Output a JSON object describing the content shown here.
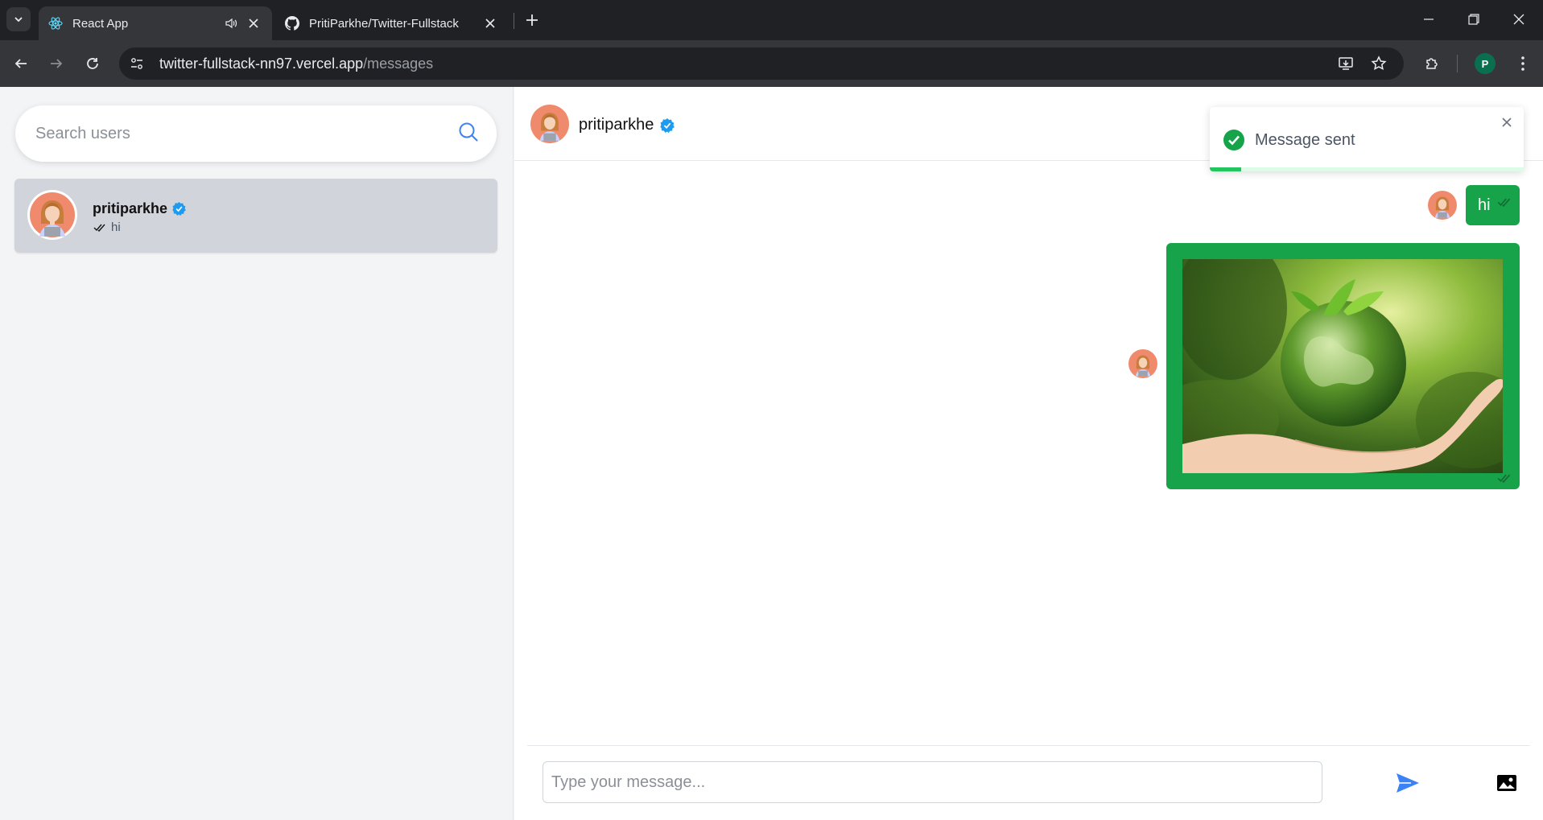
{
  "browser": {
    "tabs": [
      {
        "title": "React App",
        "favicon": "react-icon",
        "active": true
      },
      {
        "title": "PritiParkhe/Twitter-Fullstack",
        "favicon": "github-icon",
        "active": false
      }
    ],
    "url_host": "twitter-fullstack-nn97.vercel.app",
    "url_path": "/messages",
    "profile_initial": "P"
  },
  "sidebar": {
    "search_placeholder": "Search users",
    "conversations": [
      {
        "name": "pritiparkhe",
        "verified": true,
        "last_message": "hi"
      }
    ]
  },
  "chat": {
    "header_name": "pritiparkhe",
    "verified": true,
    "messages": [
      {
        "type": "text",
        "text": "hi",
        "status": "seen"
      },
      {
        "type": "image",
        "description": "hand-holding-green-globe-image",
        "status": "seen"
      }
    ],
    "composer_placeholder": "Type your message..."
  },
  "toast": {
    "text": "Message sent",
    "progress": 0.1
  },
  "colors": {
    "accent_green": "#16a34a",
    "verified_blue": "#1d9bf0",
    "send_blue": "#3b82f6"
  }
}
